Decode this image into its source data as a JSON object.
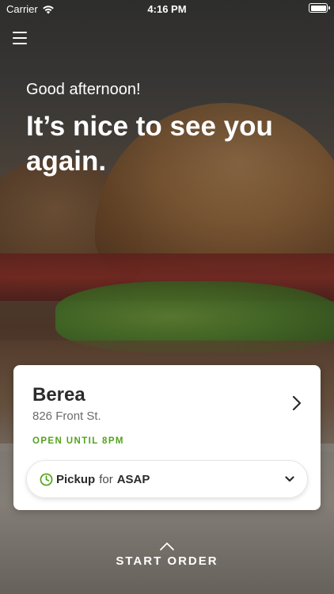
{
  "status_bar": {
    "carrier": "Carrier",
    "time": "4:16 PM",
    "wifi_icon": "wifi-icon",
    "battery_icon": "battery-icon"
  },
  "menu": {
    "icon": "hamburger-menu-icon"
  },
  "hero": {
    "greeting": "Good afternoon!",
    "headline": "It’s nice to see you again."
  },
  "location_card": {
    "store_name": "Berea",
    "address": "826 Front St.",
    "open_status": "OPEN UNTIL 8PM",
    "open_status_color": "#52a31c",
    "chevron_icon": "chevron-right-icon",
    "order_mode": {
      "icon": "clock-icon",
      "mode": "Pickup",
      "connector": "for",
      "time": "ASAP",
      "dropdown_icon": "chevron-down-icon"
    }
  },
  "start_order": {
    "icon": "chevron-up-icon",
    "label": "START ORDER"
  }
}
